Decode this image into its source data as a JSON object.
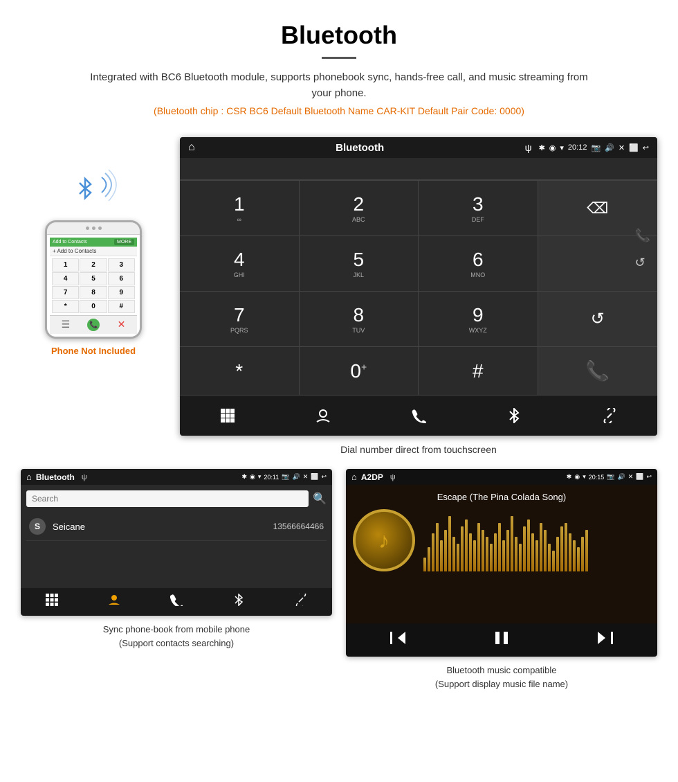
{
  "header": {
    "title": "Bluetooth",
    "description": "Integrated with BC6 Bluetooth module, supports phonebook sync, hands-free call, and music streaming from your phone.",
    "specs": "(Bluetooth chip : CSR BC6    Default Bluetooth Name CAR-KIT    Default Pair Code: 0000)"
  },
  "phone_area": {
    "not_included_label": "Phone Not Included"
  },
  "dial_screen": {
    "title": "Bluetooth",
    "time": "20:12",
    "usb_symbol": "ψ",
    "keys": [
      {
        "num": "1",
        "letters": "∞"
      },
      {
        "num": "2",
        "letters": "ABC"
      },
      {
        "num": "3",
        "letters": "DEF"
      },
      {
        "num": "",
        "letters": ""
      },
      {
        "num": "4",
        "letters": "GHI"
      },
      {
        "num": "5",
        "letters": "JKL"
      },
      {
        "num": "6",
        "letters": "MNO"
      },
      {
        "num": "",
        "letters": ""
      },
      {
        "num": "7",
        "letters": "PQRS"
      },
      {
        "num": "8",
        "letters": "TUV"
      },
      {
        "num": "9",
        "letters": "WXYZ"
      },
      {
        "num": "",
        "letters": ""
      },
      {
        "num": "*",
        "letters": ""
      },
      {
        "num": "0",
        "letters": "+"
      },
      {
        "num": "#",
        "letters": ""
      },
      {
        "num": "",
        "letters": ""
      }
    ],
    "caption": "Dial number direct from touchscreen"
  },
  "phonebook_screen": {
    "title": "Bluetooth",
    "time": "20:11",
    "search_placeholder": "Search",
    "contact": {
      "letter": "S",
      "name": "Seicane",
      "phone": "13566664466"
    },
    "caption_line1": "Sync phone-book from mobile phone",
    "caption_line2": "(Support contacts searching)"
  },
  "music_screen": {
    "title": "A2DP",
    "time": "20:15",
    "song_title": "Escape (The Pina Colada Song)",
    "note_symbol": "♪",
    "caption_line1": "Bluetooth music compatible",
    "caption_line2": "(Support display music file name)"
  },
  "watermark": "Seicane",
  "viz_bars": [
    20,
    35,
    55,
    70,
    45,
    60,
    80,
    50,
    40,
    65,
    75,
    55,
    45,
    70,
    60,
    50,
    40,
    55,
    70,
    45,
    60,
    80,
    50,
    40,
    65,
    75,
    55,
    45,
    70,
    60,
    40,
    30,
    50,
    65,
    70,
    55,
    45,
    35,
    50,
    60
  ]
}
